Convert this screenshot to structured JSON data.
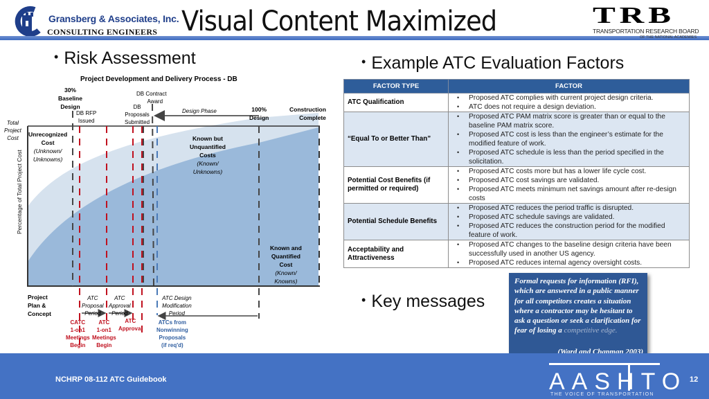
{
  "header": {
    "title": "Visual Content Maximized",
    "left_logo": {
      "name": "Gransberg & Associates, Inc.",
      "subtitle": "CONSULTING ENGINEERS"
    },
    "right_logo": {
      "mark": "TRB",
      "line1": "TRANSPORTATION RESEARCH BOARD",
      "line2": "OF THE NATIONAL ACADEMIES"
    }
  },
  "left_section": {
    "heading": "Risk Assessment",
    "diagram": {
      "title": "Project Development and Delivery Process - DB",
      "y_axis_label": "Percentage of Total Project Cost",
      "y_top_label": [
        "Total",
        "Project",
        "Cost"
      ],
      "milestones_top": {
        "baseline": [
          "30%",
          "Baseline",
          "Design"
        ],
        "rfp": [
          "DB RFP",
          "Issued"
        ],
        "proposals": [
          "DB",
          "Proposals",
          "Submitted"
        ],
        "award": [
          "DB Contract",
          "Award"
        ],
        "design_phase": "Design Phase",
        "full_design": [
          "100%",
          "Design"
        ],
        "complete": [
          "Construction",
          "Complete"
        ]
      },
      "regions": {
        "unrecognized": {
          "title": [
            "Unrecognized",
            "Cost"
          ],
          "sub": [
            "(Unknown/",
            "Unknowns)"
          ]
        },
        "unquantified": {
          "title": [
            "Known but",
            "Unquantified",
            "Costs"
          ],
          "sub": [
            "(Known/",
            "Unknowns)"
          ]
        },
        "quantified": {
          "title": [
            "Known and",
            "Quantified",
            "Cost"
          ],
          "sub": [
            "(Known/",
            "Knowns)"
          ]
        }
      },
      "bottom": {
        "project_plan": [
          "Project",
          "Plan &",
          "Concept"
        ],
        "proposal_period": [
          "ATC",
          "Proposal",
          "Period"
        ],
        "approval_period": [
          "ATC",
          "Approval",
          "Period"
        ],
        "design_mod_period": [
          "ATC Design",
          "Modification",
          "Period"
        ],
        "catc_meetings": [
          "CATC",
          "1-on1",
          "Meetings",
          "Begin"
        ],
        "atc_meetings": [
          "ATC",
          "1-on1",
          "Meetings",
          "Begin"
        ],
        "atc_approval": [
          "ATC",
          "Approval"
        ],
        "nonwinning": [
          "ATCs from",
          "Nonwinning",
          "Proposals",
          "(if req'd)"
        ]
      }
    }
  },
  "right_section": {
    "heading": "Example ATC Evaluation Factors",
    "table": {
      "headers": [
        "FACTOR TYPE",
        "FACTOR"
      ],
      "rows": [
        {
          "type": "ATC Qualification",
          "factors": [
            "Proposed ATC complies with current project design criteria.",
            "ATC does not require a design deviation."
          ]
        },
        {
          "type": "“Equal To or Better Than”",
          "factors": [
            "Proposed ATC PAM matrix score is greater than or equal to the baseline PAM matrix score.",
            "Proposed ATC cost is less than the engineer’s estimate for the modified feature of work.",
            "Proposed ATC schedule is less than the period specified in the solicitation."
          ]
        },
        {
          "type": "Potential Cost Benefits (if permitted or required)",
          "factors": [
            "Proposed ATC costs more but has a lower life cycle cost.",
            "Proposed ATC cost savings are validated.",
            "Proposed ATC meets minimum net savings amount after re-design costs"
          ]
        },
        {
          "type": "Potential Schedule Benefits",
          "factors": [
            "Proposed ATC reduces the period traffic is disrupted.",
            "Proposed ATC schedule savings are validated.",
            "Proposed ATC reduces the construction period for the modified feature of work."
          ]
        },
        {
          "type": "Acceptability and Attractiveness",
          "factors": [
            "Proposed ATC changes to the baseline design criteria have been successfully used in another US agency.",
            "Proposed ATC reduces internal agency oversight costs."
          ]
        }
      ]
    },
    "key_messages_heading": "Key messages",
    "quote": {
      "text": "Formal requests for information (RFI), which are answered in a public manner for all competitors creates a situation where a contractor may be hesitant to ask a question or seek a clarification for fear of losing a",
      "faded_text": "competitive edge.",
      "citation": "(Ward and Chapman 2003)"
    }
  },
  "footer": {
    "text": "NCHRP 08-112 ATC Guidebook",
    "logo_text": "AASHTO",
    "logo_tagline": "THE VOICE OF TRANSPORTATION",
    "page_number": "12"
  },
  "colors": {
    "accent": "#4472c4",
    "table_header": "#2e5d9a",
    "red_marker": "#c0101e",
    "blue_marker": "#4a7ab8"
  }
}
